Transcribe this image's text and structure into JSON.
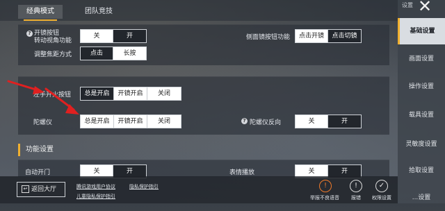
{
  "tabs": [
    "经典模式",
    "团队竞技"
  ],
  "sidebar": {
    "header": "设置",
    "close": "✕",
    "items": [
      "基础设置",
      "画面设置",
      "操作设置",
      "载具设置",
      "灵敏度设置",
      "拾取设置",
      "...设置"
    ]
  },
  "panel1": {
    "toggle_label": [
      "开镜按钮",
      "转动视角功能"
    ],
    "toggle_opts": [
      "关",
      "开"
    ],
    "focus_label": "调整焦距方式",
    "focus_opts": [
      "点击",
      "长按"
    ],
    "side_scope_label": "侧面镜按钮功能",
    "side_scope_opts": [
      "点击开镜",
      "点击切镜"
    ]
  },
  "panel2": {
    "fire_label": "左手开火按钮",
    "fire_opts": [
      "总是开启",
      "开镜开启",
      "关闭"
    ],
    "gyro_label": "陀螺仪",
    "gyro_opts": [
      "总是开启",
      "开镜开启",
      "关闭"
    ],
    "gyro_rev_label": "陀螺仪反向",
    "gyro_rev_opts": [
      "关",
      "开"
    ]
  },
  "section": {
    "title": "功能设置",
    "auto_door_label": "自动开门",
    "auto_door_opts": [
      "关",
      "开"
    ],
    "emote_label": "表情播放",
    "emote_opts": [
      "关",
      "开"
    ]
  },
  "bottom": {
    "back": "返回大厅",
    "links": [
      "腾讯游戏用户协议",
      "隐私保护指引",
      "儿童隐私保护指引"
    ],
    "icons": [
      {
        "label": "举报不良语音",
        "icon": "warning-icon"
      },
      {
        "label": "报错",
        "icon": "alert-icon"
      },
      {
        "label": "权限设置",
        "icon": "shield-check-icon"
      }
    ]
  },
  "colors": {
    "accent": "#f0b030",
    "annotation": "#e02020",
    "selected": "#22262c"
  }
}
